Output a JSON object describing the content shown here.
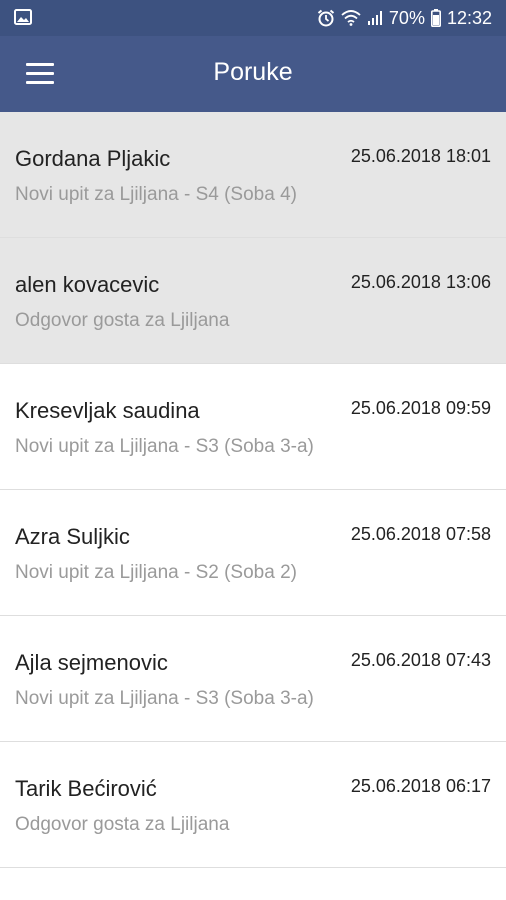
{
  "status_bar": {
    "battery": "70%",
    "time": "12:32",
    "icons": [
      "image-icon",
      "alarm-icon",
      "wifi-icon",
      "signal-icon",
      "battery-icon"
    ]
  },
  "app_bar": {
    "title": "Poruke",
    "menu_icon": "hamburger-menu-icon"
  },
  "messages": [
    {
      "name": "Gordana Pljakic",
      "date": "25.06.2018 18:01",
      "subtitle": "Novi upit za Ljiljana - S4 (Soba 4)",
      "unread": true
    },
    {
      "name": "alen kovacevic",
      "date": "25.06.2018 13:06",
      "subtitle": "Odgovor gosta za Ljiljana",
      "unread": true
    },
    {
      "name": "Kresevljak saudina",
      "date": "25.06.2018 09:59",
      "subtitle": "Novi upit za Ljiljana - S3 (Soba 3-a)",
      "unread": false
    },
    {
      "name": "Azra Suljkic",
      "date": "25.06.2018 07:58",
      "subtitle": "Novi upit za Ljiljana - S2 (Soba 2)",
      "unread": false
    },
    {
      "name": "Ajla sejmenovic",
      "date": "25.06.2018 07:43",
      "subtitle": "Novi upit za Ljiljana - S3 (Soba 3-a)",
      "unread": false
    },
    {
      "name": "Tarik Bećirović",
      "date": "25.06.2018 06:17",
      "subtitle": "Odgovor gosta za Ljiljana",
      "unread": false
    }
  ],
  "colors": {
    "status_bar": "#3d5280",
    "app_bar": "#45598a",
    "unread_bg": "#e6e6e6",
    "subtitle": "#9a9a9a"
  }
}
